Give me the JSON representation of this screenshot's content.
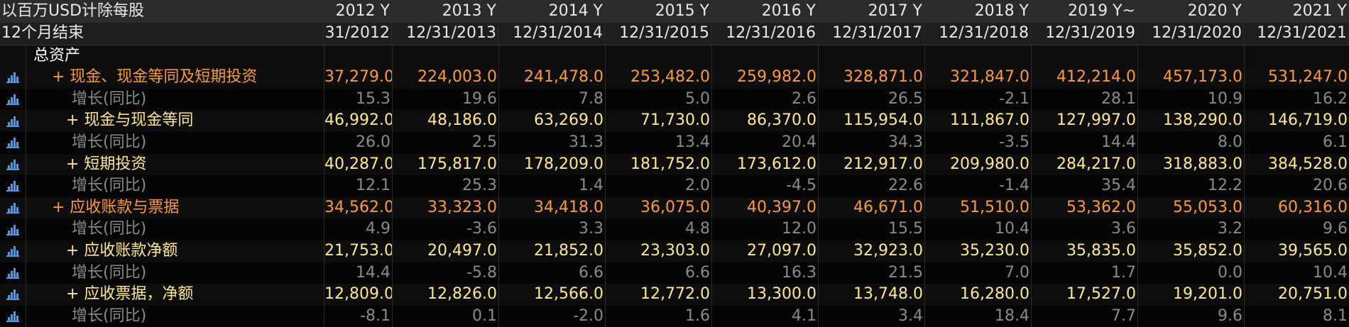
{
  "header": {
    "units": "以百万USD计除每股",
    "period_label": "12个月结束",
    "years": [
      "2012 Y",
      "2013 Y",
      "2014 Y",
      "2015 Y",
      "2016 Y",
      "2017 Y",
      "2018 Y",
      "2019 Y~",
      "2020 Y",
      "2021 Y"
    ],
    "dates": [
      "31/2012",
      "12/31/2013",
      "12/31/2014",
      "12/31/2015",
      "12/31/2016",
      "12/31/2017",
      "12/31/2018",
      "12/31/2019",
      "12/31/2020",
      "12/31/2021"
    ]
  },
  "section_title": "总资产",
  "rows": [
    {
      "label": "+ 现金、现金等同及短期投资",
      "color": "orange",
      "indent": 1,
      "icon": true,
      "values": [
        "37,279.0",
        "224,003.0",
        "241,478.0",
        "253,482.0",
        "259,982.0",
        "328,871.0",
        "321,847.0",
        "412,214.0",
        "457,173.0",
        "531,247.0"
      ]
    },
    {
      "label": "增长(同比)",
      "color": "grey",
      "indent": 3,
      "icon": true,
      "values": [
        "15.3",
        "19.6",
        "7.8",
        "5.0",
        "2.6",
        "26.5",
        "-2.1",
        "28.1",
        "10.9",
        "16.2"
      ]
    },
    {
      "label": "+ 现金与现金等同",
      "color": "yellow",
      "indent": 2,
      "icon": true,
      "values": [
        "46,992.0",
        "48,186.0",
        "63,269.0",
        "71,730.0",
        "86,370.0",
        "115,954.0",
        "111,867.0",
        "127,997.0",
        "138,290.0",
        "146,719.0"
      ]
    },
    {
      "label": "增长(同比)",
      "color": "grey",
      "indent": 3,
      "icon": true,
      "values": [
        "26.0",
        "2.5",
        "31.3",
        "13.4",
        "20.4",
        "34.3",
        "-3.5",
        "14.4",
        "8.0",
        "6.1"
      ]
    },
    {
      "label": "+ 短期投资",
      "color": "yellow",
      "indent": 2,
      "icon": true,
      "values": [
        "40,287.0",
        "175,817.0",
        "178,209.0",
        "181,752.0",
        "173,612.0",
        "212,917.0",
        "209,980.0",
        "284,217.0",
        "318,883.0",
        "384,528.0"
      ]
    },
    {
      "label": "增长(同比)",
      "color": "grey",
      "indent": 3,
      "icon": true,
      "values": [
        "12.1",
        "25.3",
        "1.4",
        "2.0",
        "-4.5",
        "22.6",
        "-1.4",
        "35.4",
        "12.2",
        "20.6"
      ]
    },
    {
      "label": "+ 应收账款与票据",
      "color": "orange",
      "indent": 1,
      "icon": true,
      "values": [
        "34,562.0",
        "33,323.0",
        "34,418.0",
        "36,075.0",
        "40,397.0",
        "46,671.0",
        "51,510.0",
        "53,362.0",
        "55,053.0",
        "60,316.0"
      ]
    },
    {
      "label": "增长(同比)",
      "color": "grey",
      "indent": 3,
      "icon": true,
      "values": [
        "4.9",
        "-3.6",
        "3.3",
        "4.8",
        "12.0",
        "15.5",
        "10.4",
        "3.6",
        "3.2",
        "9.6"
      ]
    },
    {
      "label": "+ 应收账款净额",
      "color": "yellow",
      "indent": 2,
      "icon": true,
      "values": [
        "21,753.0",
        "20,497.0",
        "21,852.0",
        "23,303.0",
        "27,097.0",
        "32,923.0",
        "35,230.0",
        "35,835.0",
        "35,852.0",
        "39,565.0"
      ]
    },
    {
      "label": "增长(同比)",
      "color": "grey",
      "indent": 3,
      "icon": true,
      "values": [
        "14.4",
        "-5.8",
        "6.6",
        "6.6",
        "16.3",
        "21.5",
        "7.0",
        "1.7",
        "0.0",
        "10.4"
      ]
    },
    {
      "label": "+ 应收票据，净额",
      "color": "yellow",
      "indent": 2,
      "icon": true,
      "values": [
        "12,809.0",
        "12,826.0",
        "12,566.0",
        "12,772.0",
        "13,300.0",
        "13,748.0",
        "16,280.0",
        "17,527.0",
        "19,201.0",
        "20,751.0"
      ]
    },
    {
      "label": "增长(同比)",
      "color": "grey",
      "indent": 3,
      "icon": true,
      "values": [
        "-8.1",
        "0.1",
        "-2.0",
        "1.6",
        "4.1",
        "3.4",
        "18.4",
        "7.7",
        "9.6",
        "8.1"
      ]
    }
  ],
  "colors": {
    "orange": "#ff9a2e",
    "yellow": "#ffe88a",
    "grey": "#8a8a8a",
    "icon": "#3f9cff"
  }
}
